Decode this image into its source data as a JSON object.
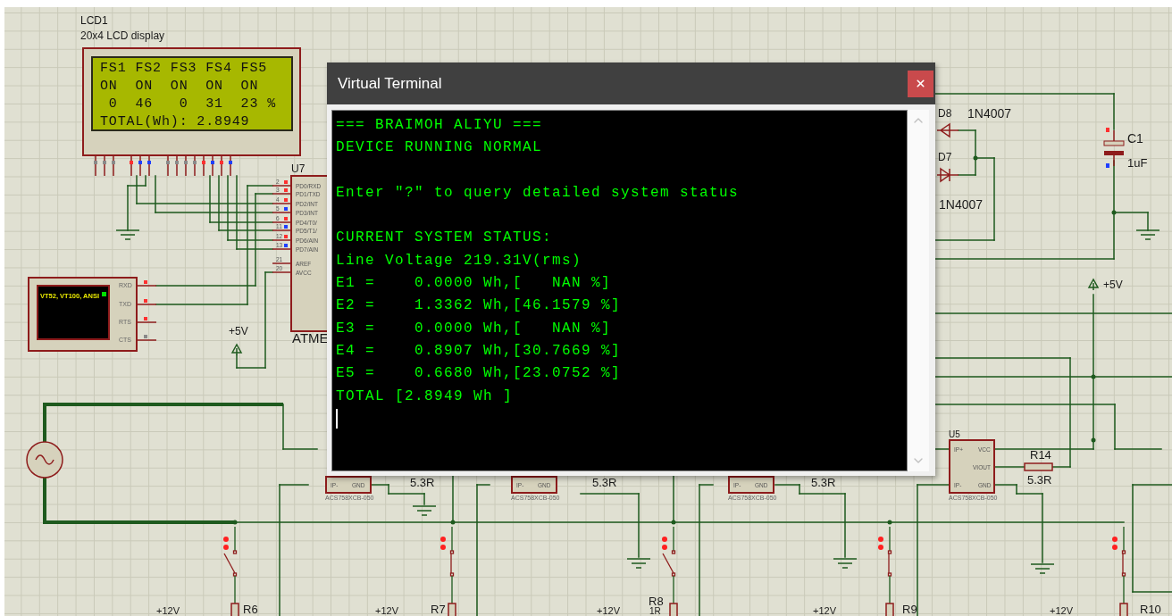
{
  "schematic": {
    "lcd": {
      "ref": "LCD1",
      "description": "20x4 LCD display",
      "rows": [
        "FS1 FS2 FS3 FS4 FS5",
        "ON  ON  ON  ON  ON",
        " 0  46   0  31  23 %",
        "TOTAL(Wh): 2.8949"
      ],
      "pins": [
        {
          "color": "#8a8a8a"
        },
        {
          "color": "#8a8a8a"
        },
        {
          "color": "#8a8a8a"
        },
        {
          "color": "#ff3030"
        },
        {
          "color": "#2040ff"
        },
        {
          "color": "#2040ff"
        },
        {
          "color": "#8a8a8a"
        },
        {
          "color": "#8a8a8a"
        },
        {
          "color": "#8a8a8a"
        },
        {
          "color": "#8a8a8a"
        },
        {
          "color": "#ff3030"
        },
        {
          "color": "#2040ff"
        },
        {
          "color": "#ff3030"
        },
        {
          "color": "#2040ff"
        }
      ]
    },
    "mcu": {
      "ref": "U7",
      "name": "ATME",
      "pins": [
        {
          "number": "2",
          "name": "PD0/RXD",
          "color": "#ff3030"
        },
        {
          "number": "3",
          "name": "PD1/TXD",
          "color": "#ff3030"
        },
        {
          "number": "4",
          "name": "PD2/INT",
          "color": "#ff3030"
        },
        {
          "number": "5",
          "name": "PD3/INT",
          "color": "#2040ff"
        },
        {
          "number": "6",
          "name": "PD4/T0/",
          "color": "#ff3030"
        },
        {
          "number": "11",
          "name": "PD5/T1/",
          "color": "#2040ff"
        },
        {
          "number": "12",
          "name": "PD6/AIN",
          "color": "#ff3030"
        },
        {
          "number": "13",
          "name": "PD7/AIN",
          "color": "#2040ff"
        },
        {
          "number": "21",
          "name": "AREF"
        },
        {
          "number": "20",
          "name": "AVCC"
        }
      ]
    },
    "terminal_device": {
      "screen_text": "VT52, VT100, ANSI",
      "pins": [
        {
          "name": "RXD",
          "color": "#ff3030"
        },
        {
          "name": "TXD",
          "color": "#ff3030"
        },
        {
          "name": "RTS",
          "color": "#ff3030"
        },
        {
          "name": "CTS",
          "color": "#8a8a8a"
        }
      ]
    },
    "power_labels": [
      "+5V",
      "+5V"
    ],
    "diodes": [
      {
        "ref": "D8",
        "value": "1N4007"
      },
      {
        "ref": "D7",
        "value": "1N4007"
      }
    ],
    "capacitor": {
      "ref": "C1",
      "value": "1uF"
    },
    "current_sensors": [
      {
        "pins": [
          "IP-",
          "GND"
        ],
        "part": "ACS758XCB-050"
      },
      {
        "pins": [
          "IP-",
          "GND"
        ],
        "part": "ACS758XCB-050"
      },
      {
        "pins": [
          "IP-",
          "GND"
        ],
        "part": "ACS758XCB-050"
      },
      {
        "ref": "U5",
        "pins": [
          "IP+",
          "VCC",
          "VIOUT",
          "IP-",
          "GND"
        ],
        "part": "ACS758XCB-050"
      }
    ],
    "shunt_labels": [
      "5.3R",
      "5.3R",
      "5.3R"
    ],
    "sense_resistor": {
      "ref": "R14",
      "value": "5.3R"
    },
    "switches": [
      {
        "closed": false
      },
      {
        "closed": true
      },
      {
        "closed": false
      },
      {
        "closed": true
      },
      {
        "closed": true
      }
    ],
    "load_resistors": [
      {
        "ref": "R6"
      },
      {
        "ref": "R7"
      },
      {
        "ref": "R8",
        "value": "1R"
      },
      {
        "ref": "R9"
      },
      {
        "ref": "R10"
      }
    ],
    "supply_labels": [
      "+12V",
      "+12V",
      "+12V",
      "+12V",
      "+12V"
    ]
  },
  "terminal_window": {
    "title": "Virtual Terminal",
    "blocks": [
      [
        "=== BRAIMOH ALIYU ===",
        "DEVICE RUNNING NORMAL"
      ],
      [
        "Enter \"?\" to query detailed system status"
      ],
      [
        "CURRENT SYSTEM STATUS:",
        "Line Voltage 219.31V(rms)",
        "E1 =    0.0000 Wh,[   NAN %]",
        "E2 =    1.3362 Wh,[46.1579 %]",
        "E3 =    0.0000 Wh,[   NAN %]",
        "E4 =    0.8907 Wh,[30.7669 %]",
        "E5 =    0.6680 Wh,[23.0752 %]",
        "TOTAL [2.8949 Wh ]"
      ]
    ]
  }
}
